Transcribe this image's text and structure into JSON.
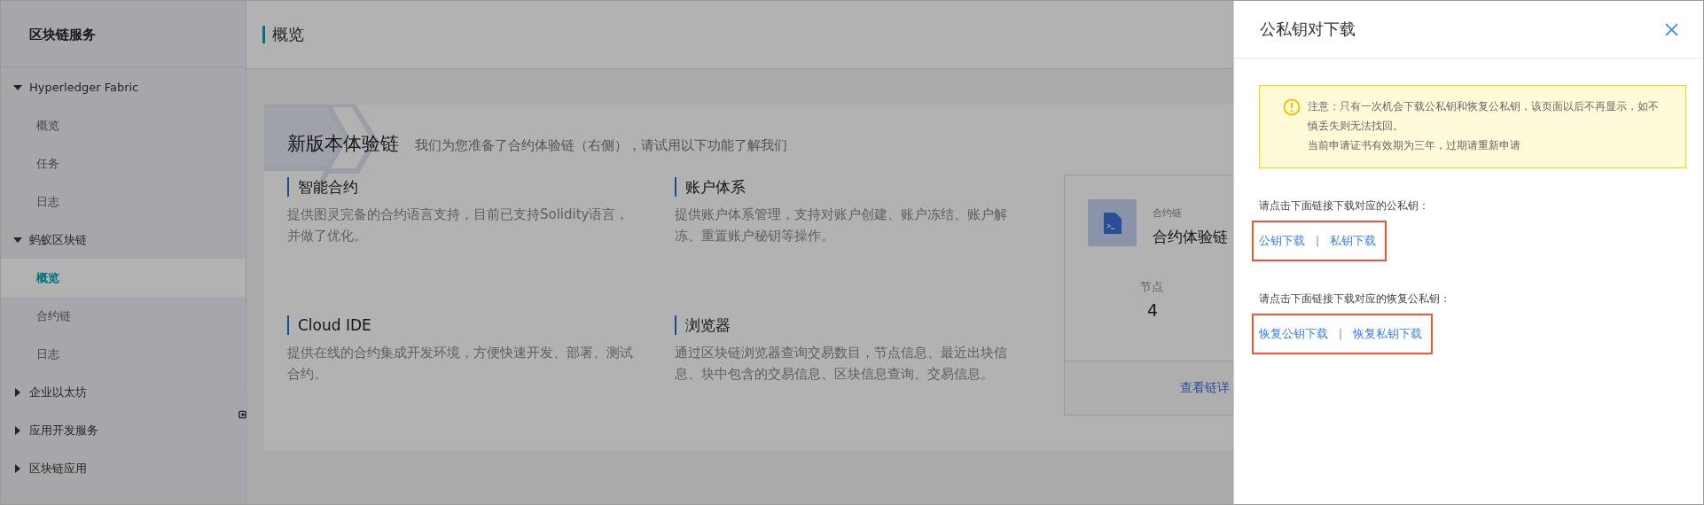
{
  "sidebar": {
    "title": "区块链服务",
    "groups": [
      {
        "label": "Hyperledger Fabric",
        "expanded": true,
        "children": [
          {
            "label": "概览",
            "selected": false
          },
          {
            "label": "任务",
            "selected": false
          },
          {
            "label": "日志",
            "selected": false
          }
        ]
      },
      {
        "label": "蚂蚁区块链",
        "expanded": true,
        "children": [
          {
            "label": "概览",
            "selected": true
          },
          {
            "label": "合约链",
            "selected": false
          },
          {
            "label": "日志",
            "selected": false
          }
        ]
      },
      {
        "label": "企业以太坊",
        "expanded": false
      },
      {
        "label": "应用开发服务",
        "expanded": false
      },
      {
        "label": "区块链应用",
        "expanded": false
      }
    ]
  },
  "header": {
    "title": "概览"
  },
  "intro": {
    "title": "新版本体验链",
    "subtitle": "我们为您准备了合约体验链（右侧），请试用以下功能了解我们"
  },
  "features": [
    {
      "title": "智能合约",
      "description": "提供图灵完备的合约语言支持，目前已支持Solidity语言，并做了优化。"
    },
    {
      "title": "账户体系",
      "description": "提供账户体系管理，支持对账户创建、账户冻结、账户解冻、重置账户秘钥等操作。"
    },
    {
      "title": "Cloud IDE",
      "description": "提供在线的合约集成开发环境，方便快速开发、部署、测试合约。"
    },
    {
      "title": "浏览器",
      "description": "通过区块链浏览器查询交易数目，节点信息、最近出块信息、块中包含的交易信息、区块信息查询、交易信息。"
    }
  ],
  "chain_card": {
    "label": "合约链",
    "name": "合约体验链",
    "stat_label": "节点",
    "stat_value": "4",
    "link": "查看链详"
  },
  "drawer": {
    "title": "公私钥对下载",
    "notice": [
      "注意：只有一次机会下载公私钥和恢复公私钥，该页面以后不再显示，如不慎丢失则无法找回。",
      "当前申请证书有效期为三年，过期请重新申请"
    ],
    "sections": [
      {
        "prompt": "请点击下面链接下载对应的公私钥：",
        "links": [
          "公钥下载",
          "私钥下载"
        ],
        "separator": "|"
      },
      {
        "prompt": "请点击下面链接下载对应的恢复公私钥：",
        "links": [
          "恢复公钥下载",
          "恢复私钥下载"
        ],
        "separator": "|"
      }
    ]
  }
}
